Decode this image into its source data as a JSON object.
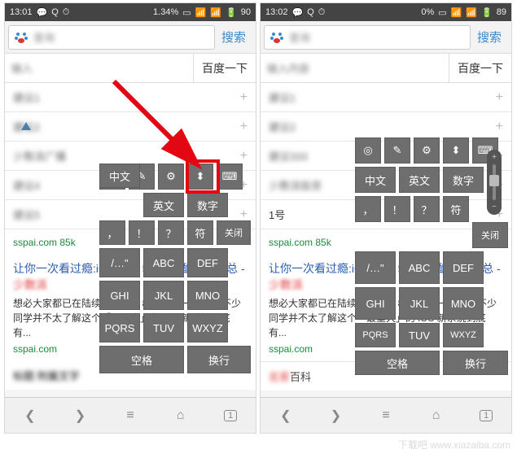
{
  "left": {
    "status": {
      "time": "13:01",
      "battery": "90",
      "pct": "1.34%"
    },
    "search_action": "搜索",
    "baidu_btn": "百度一下",
    "sspai_src": "sspai.com 85k",
    "result_title_a": "让你一次看过瘾:iOS 8 的 51 个炫酷功能汇总 - ",
    "result_title_b": "少数派",
    "snippet": "想必大家都已在陆续升级 iOS 8 了,但是一定还有不少同学并不太了解这个「最重大」的 iOS 新系统到底有...",
    "result_src": "sspai.com",
    "kbd": {
      "lang_cn": "中文",
      "lang_en": "英文",
      "lang_num": "数字",
      "comma": "，",
      "excl": "！",
      "ques": "？",
      "sym": "符",
      "close": "关闭",
      "quote": "/…\"",
      "abc": "ABC",
      "def": "DEF",
      "ghi": "GHI",
      "jkl": "JKL",
      "mno": "MNO",
      "pqrs": "PQRS",
      "tuv": "TUV",
      "wxyz": "WXYZ",
      "space": "空格",
      "enter": "换行"
    }
  },
  "right": {
    "status": {
      "time": "13:02",
      "battery": "89",
      "pct": "0%"
    },
    "search_action": "搜索",
    "baidu_btn": "百度一下",
    "sspai_src": "sspai.com 85k",
    "result_title_a": "让你一次看过瘾:iOS 8 的 51 个炫酷功能汇总 - ",
    "result_title_b": "少数派",
    "snippet": "想必大家都已在陆续升级 iOS 8 了,但是一定还有不少同学并不太了解这个「最重大」的 iOS 新系统到底有...",
    "result_src": "sspai.com",
    "encyc_prefix": "名家",
    "encyc": "百科",
    "slider_label": "1号",
    "kbd": {
      "lang_cn": "中文",
      "lang_en": "英文",
      "lang_num": "数字",
      "comma": "，",
      "excl": "！",
      "ques": "？",
      "sym": "符",
      "close": "关闭",
      "quote": "/…\"",
      "abc": "ABC",
      "def": "DEF",
      "ghi": "GHI",
      "jkl": "JKL",
      "mno": "MNO",
      "pqrs": "PQRS",
      "tuv": "TUV",
      "wxyz": "WXYZ",
      "space": "空格",
      "enter": "换行"
    }
  }
}
